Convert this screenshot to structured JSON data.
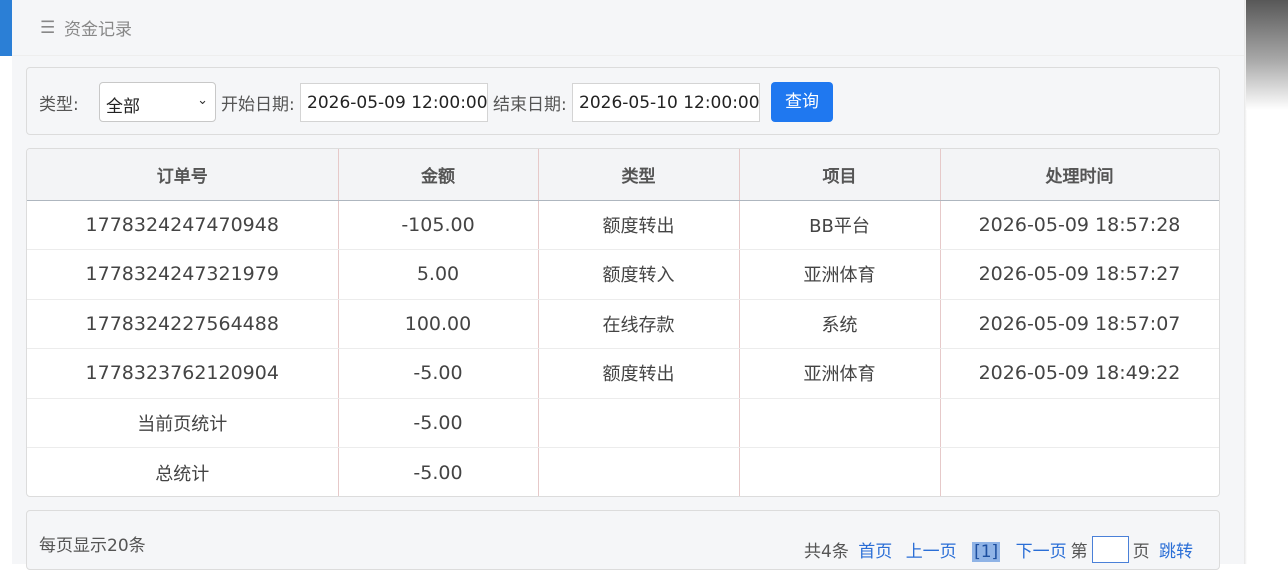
{
  "header": {
    "title": "资金记录",
    "menu_icon": "menu-icon"
  },
  "filter": {
    "type_label": "类型:",
    "type_value": "全部",
    "start_label": "开始日期:",
    "start_value": "2026-05-09 12:00:00",
    "end_label": "结束日期:",
    "end_value": "2026-05-10 12:00:00",
    "query_label": "查询"
  },
  "table": {
    "headers": [
      "订单号",
      "金额",
      "类型",
      "项目",
      "处理时间"
    ],
    "rows": [
      [
        "1778324247470948",
        "-105.00",
        "额度转出",
        "BB平台",
        "2026-05-09 18:57:28"
      ],
      [
        "1778324247321979",
        "5.00",
        "额度转入",
        "亚洲体育",
        "2026-05-09 18:57:27"
      ],
      [
        "1778324227564488",
        "100.00",
        "在线存款",
        "系统",
        "2026-05-09 18:57:07"
      ],
      [
        "1778323762120904",
        "-5.00",
        "额度转出",
        "亚洲体育",
        "2026-05-09 18:49:22"
      ]
    ],
    "page_total_label": "当前页统计",
    "page_total_value": "-5.00",
    "grand_total_label": "总统计",
    "grand_total_value": "-5.00"
  },
  "pager": {
    "per_page": "每页显示20条",
    "total": "共4条",
    "first": "首页",
    "prev": "上一页",
    "current": "[1]",
    "next": "下一页",
    "goto_prefix": "第",
    "goto_suffix": "页",
    "goto": "跳转"
  }
}
